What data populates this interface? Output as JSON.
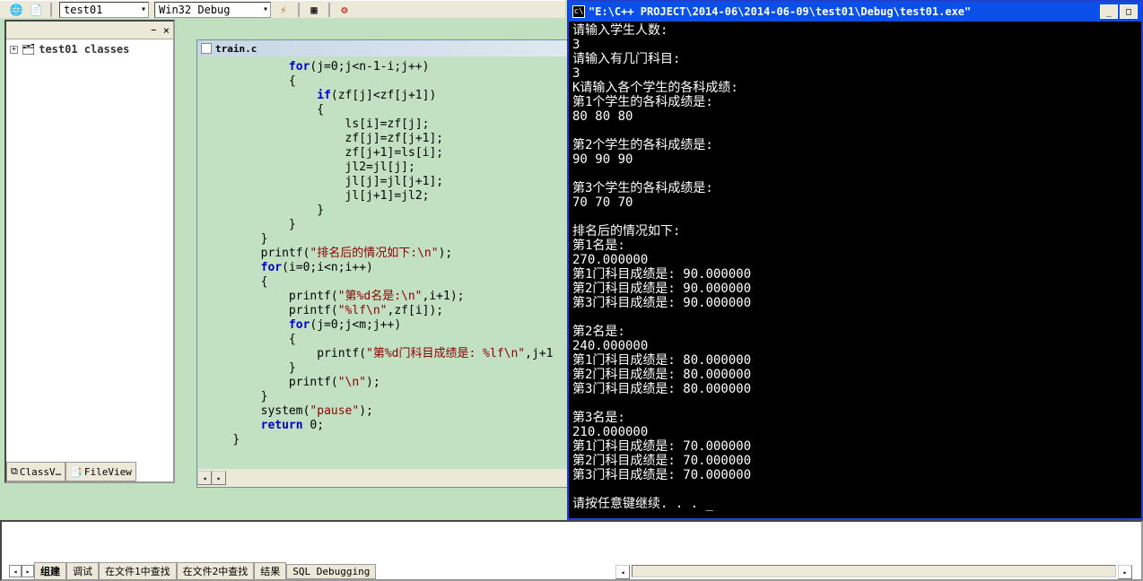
{
  "toolbar": {
    "combo1_value": "test01",
    "combo2_value": "Win32 Debug"
  },
  "classview": {
    "root": "test01 classes",
    "tabs": [
      "ClassV…",
      "FileView"
    ]
  },
  "editor": {
    "filename": "train.c",
    "code_lines": [
      {
        "indent": 3,
        "segs": [
          {
            "t": "for",
            "c": "kw"
          },
          {
            "t": "(j=0;j<n-1-i;j++)"
          }
        ]
      },
      {
        "indent": 3,
        "segs": [
          {
            "t": "{"
          }
        ]
      },
      {
        "indent": 4,
        "segs": [
          {
            "t": "if",
            "c": "kw"
          },
          {
            "t": "(zf[j]<zf[j+1])"
          }
        ]
      },
      {
        "indent": 4,
        "segs": [
          {
            "t": "{"
          }
        ]
      },
      {
        "indent": 5,
        "segs": [
          {
            "t": "ls[i]=zf[j];"
          }
        ]
      },
      {
        "indent": 5,
        "segs": [
          {
            "t": "zf[j]=zf[j+1];"
          }
        ]
      },
      {
        "indent": 5,
        "segs": [
          {
            "t": "zf[j+1]=ls[i];"
          }
        ]
      },
      {
        "indent": 5,
        "segs": [
          {
            "t": "jl2=jl[j];"
          }
        ]
      },
      {
        "indent": 5,
        "segs": [
          {
            "t": "jl[j]=jl[j+1];"
          }
        ]
      },
      {
        "indent": 5,
        "segs": [
          {
            "t": "jl[j+1]=jl2;"
          }
        ]
      },
      {
        "indent": 4,
        "segs": [
          {
            "t": "}"
          }
        ]
      },
      {
        "indent": 3,
        "segs": [
          {
            "t": "}"
          }
        ]
      },
      {
        "indent": 2,
        "segs": [
          {
            "t": "}"
          }
        ]
      },
      {
        "indent": 2,
        "segs": [
          {
            "t": "printf("
          },
          {
            "t": "\"排名后的情况如下:\\n\"",
            "c": "str"
          },
          {
            "t": ");"
          }
        ]
      },
      {
        "indent": 2,
        "segs": [
          {
            "t": "for",
            "c": "kw"
          },
          {
            "t": "(i=0;i<n;i++)"
          }
        ]
      },
      {
        "indent": 2,
        "segs": [
          {
            "t": "{"
          }
        ]
      },
      {
        "indent": 3,
        "segs": [
          {
            "t": "printf("
          },
          {
            "t": "\"第%d名是:\\n\"",
            "c": "str"
          },
          {
            "t": ",i+1);"
          }
        ]
      },
      {
        "indent": 3,
        "segs": [
          {
            "t": "printf("
          },
          {
            "t": "\"%lf\\n\"",
            "c": "str"
          },
          {
            "t": ",zf[i]);"
          }
        ]
      },
      {
        "indent": 3,
        "segs": [
          {
            "t": "for",
            "c": "kw"
          },
          {
            "t": "(j=0;j<m;j++)"
          }
        ]
      },
      {
        "indent": 3,
        "segs": [
          {
            "t": "{"
          }
        ]
      },
      {
        "indent": 4,
        "segs": [
          {
            "t": "printf("
          },
          {
            "t": "\"第%d门科目成绩是: %lf\\n\"",
            "c": "str"
          },
          {
            "t": ",j+1"
          }
        ]
      },
      {
        "indent": 3,
        "segs": [
          {
            "t": "}"
          }
        ]
      },
      {
        "indent": 3,
        "segs": [
          {
            "t": "printf("
          },
          {
            "t": "\"\\n\"",
            "c": "str"
          },
          {
            "t": ");"
          }
        ]
      },
      {
        "indent": 2,
        "segs": [
          {
            "t": "}"
          }
        ]
      },
      {
        "indent": 2,
        "segs": [
          {
            "t": "system("
          },
          {
            "t": "\"pause\"",
            "c": "str"
          },
          {
            "t": ");"
          }
        ]
      },
      {
        "indent": 2,
        "segs": [
          {
            "t": "return",
            "c": "kw"
          },
          {
            "t": " 0;"
          }
        ]
      },
      {
        "indent": 1,
        "segs": [
          {
            "t": "}"
          }
        ]
      }
    ]
  },
  "console": {
    "title": "\"E:\\C++ PROJECT\\2014-06\\2014-06-09\\test01\\Debug\\test01.exe\"",
    "lines": [
      "请输入学生人数:",
      "3",
      "请输入有几门科目:",
      "3",
      "K请输入各个学生的各科成绩:",
      "第1个学生的各科成绩是:",
      "80 80 80",
      "",
      "第2个学生的各科成绩是:",
      "90 90 90",
      "",
      "第3个学生的各科成绩是:",
      "70 70 70",
      "",
      "排名后的情况如下:",
      "第1名是:",
      "270.000000",
      "第1门科目成绩是: 90.000000",
      "第2门科目成绩是: 90.000000",
      "第3门科目成绩是: 90.000000",
      "",
      "第2名是:",
      "240.000000",
      "第1门科目成绩是: 80.000000",
      "第2门科目成绩是: 80.000000",
      "第3门科目成绩是: 80.000000",
      "",
      "第3名是:",
      "210.000000",
      "第1门科目成绩是: 70.000000",
      "第2门科目成绩是: 70.000000",
      "第3门科目成绩是: 70.000000",
      "",
      "请按任意键继续. . . _"
    ]
  },
  "output": {
    "tabs": [
      "组建",
      "调试",
      "在文件1中查找",
      "在文件2中查找",
      "结果",
      "SQL Debugging"
    ]
  }
}
